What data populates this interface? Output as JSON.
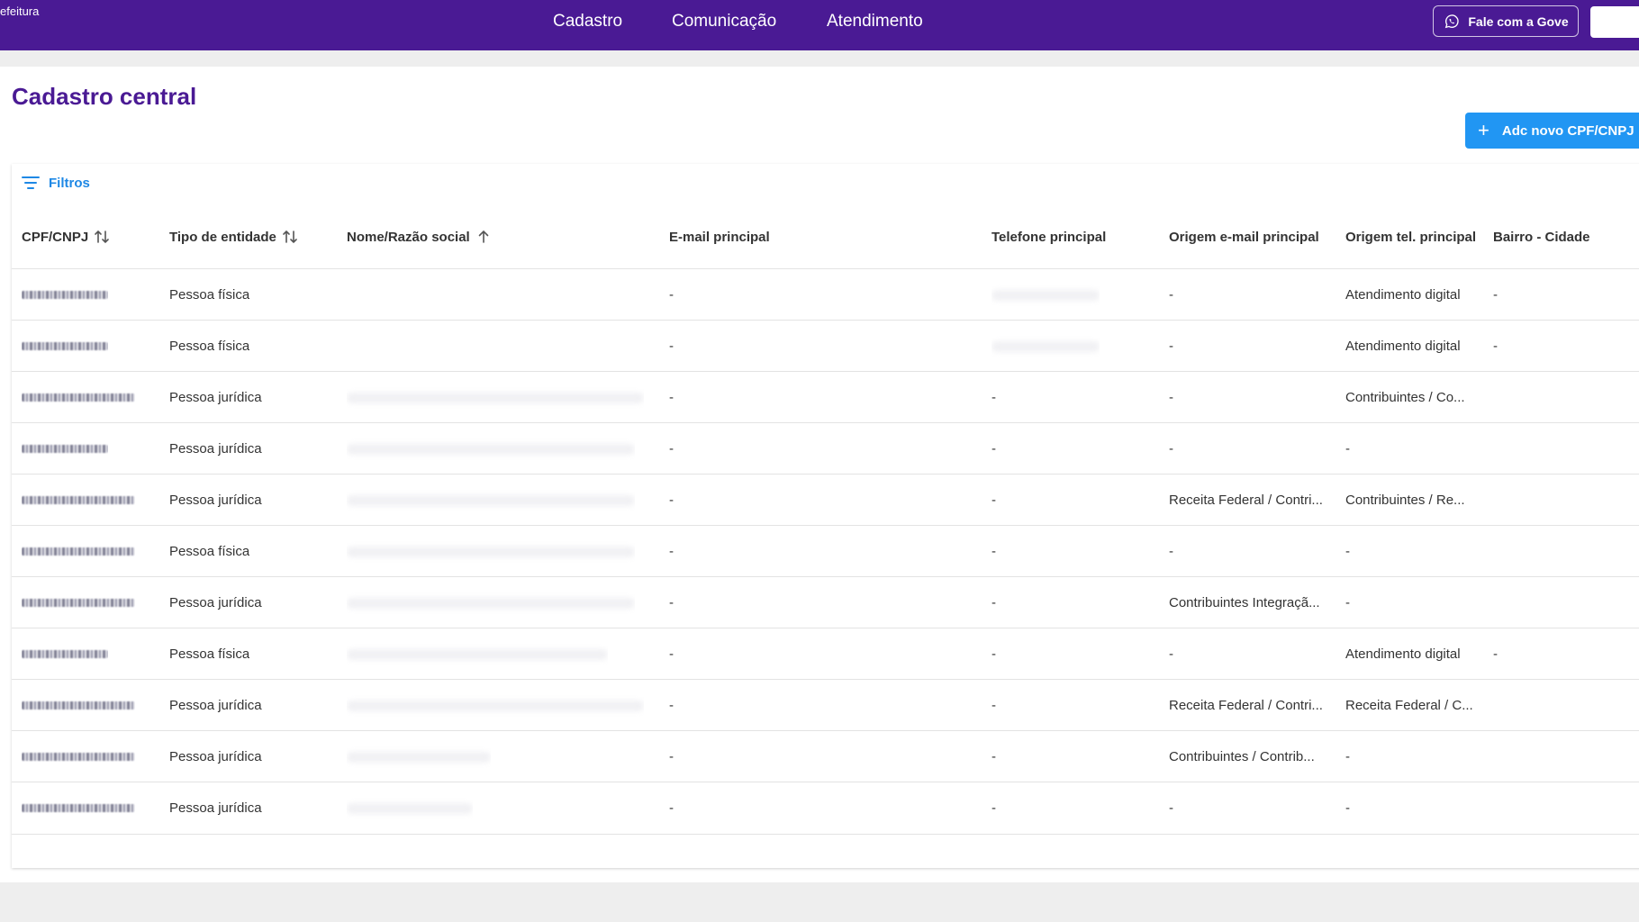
{
  "header": {
    "brand": "efeitura",
    "nav": [
      "Cadastro",
      "Comunicação",
      "Atendimento"
    ],
    "whatsapp_button": "Fale com a Gove"
  },
  "page": {
    "title": "Cadastro central",
    "add_button": "Adc novo CPF/CNPJ",
    "filters_label": "Filtros"
  },
  "table": {
    "columns": [
      "CPF/CNPJ",
      "Tipo de entidade",
      "Nome/Razão social",
      "E-mail principal",
      "Telefone principal",
      "Origem e-mail principal",
      "Origem tel. principal",
      "Bairro - Cidade"
    ],
    "rows": [
      {
        "tipo": "Pessoa física",
        "email": "-",
        "telefone": "",
        "origem_email": "-",
        "origem_tel": "Atendimento digital",
        "bairro": "-"
      },
      {
        "tipo": "Pessoa física",
        "email": "-",
        "telefone": "",
        "origem_email": "-",
        "origem_tel": "Atendimento digital",
        "bairro": "-"
      },
      {
        "tipo": "Pessoa jurídica",
        "email": "-",
        "telefone": "-",
        "origem_email": "-",
        "origem_tel": "Contribuintes / Co...",
        "bairro": ""
      },
      {
        "tipo": "Pessoa jurídica",
        "email": "-",
        "telefone": "-",
        "origem_email": "-",
        "origem_tel": "-",
        "bairro": ""
      },
      {
        "tipo": "Pessoa jurídica",
        "email": "-",
        "telefone": "-",
        "origem_email": "Receita Federal / Contri...",
        "origem_tel": "Contribuintes / Re...",
        "bairro": ""
      },
      {
        "tipo": "Pessoa física",
        "email": "-",
        "telefone": "-",
        "origem_email": "-",
        "origem_tel": "-",
        "bairro": ""
      },
      {
        "tipo": "Pessoa jurídica",
        "email": "-",
        "telefone": "-",
        "origem_email": "Contribuintes Integraçã...",
        "origem_tel": "-",
        "bairro": ""
      },
      {
        "tipo": "Pessoa física",
        "email": "-",
        "telefone": "-",
        "origem_email": "-",
        "origem_tel": "Atendimento digital",
        "bairro": "-"
      },
      {
        "tipo": "Pessoa jurídica",
        "email": "-",
        "telefone": "-",
        "origem_email": "Receita Federal / Contri...",
        "origem_tel": "Receita Federal / C...",
        "bairro": ""
      },
      {
        "tipo": "Pessoa jurídica",
        "email": "-",
        "telefone": "-",
        "origem_email": "Contribuintes / Contrib...",
        "origem_tel": "-",
        "bairro": ""
      },
      {
        "tipo": "Pessoa jurídica",
        "email": "-",
        "telefone": "-",
        "origem_email": "-",
        "origem_tel": "-",
        "bairro": ""
      }
    ]
  },
  "colors": {
    "header_bg": "#4a1a94",
    "title": "#4a1a94",
    "primary_button": "#2196f3",
    "link": "#1e88e5"
  },
  "icons": {
    "whatsapp": "whatsapp-icon",
    "add": "plus-icon",
    "filter": "filter-icon",
    "sort_both": "sort-icon",
    "sort_asc": "arrow-up-icon"
  }
}
